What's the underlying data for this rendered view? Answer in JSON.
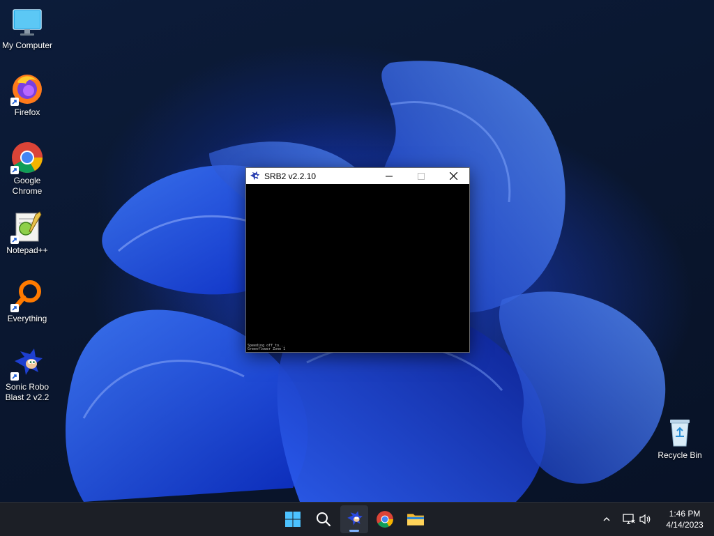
{
  "desktop": {
    "icons": [
      {
        "label": "My Computer",
        "icon": "monitor-icon"
      },
      {
        "label": "Firefox",
        "icon": "firefox-icon"
      },
      {
        "label": "Google Chrome",
        "icon": "chrome-icon"
      },
      {
        "label": "Notepad++",
        "icon": "notepadpp-icon"
      },
      {
        "label": "Everything",
        "icon": "everything-search-icon"
      },
      {
        "label": "Sonic Robo Blast 2 v2.2",
        "icon": "sonic-icon"
      },
      {
        "label": "Recycle Bin",
        "icon": "recycle-bin-icon"
      }
    ]
  },
  "window": {
    "title": "SRB2 v2.2.10",
    "console_lines": [
      "Speeding off to...",
      "Greenflower Zone 1"
    ]
  },
  "taskbar": {
    "apps": [
      {
        "name": "Start",
        "icon": "windows-logo-icon"
      },
      {
        "name": "Search",
        "icon": "search-icon"
      },
      {
        "name": "SRB2",
        "icon": "sonic-icon",
        "active": true
      },
      {
        "name": "Google Chrome",
        "icon": "chrome-icon"
      },
      {
        "name": "File Explorer",
        "icon": "folder-icon"
      }
    ],
    "clock": {
      "time": "1:46 PM",
      "date": "4/14/2023"
    }
  },
  "colors": {
    "accent": "#7fb3ff",
    "taskbar": "#1c1f26",
    "wallpaper": "#1a3cc0"
  }
}
